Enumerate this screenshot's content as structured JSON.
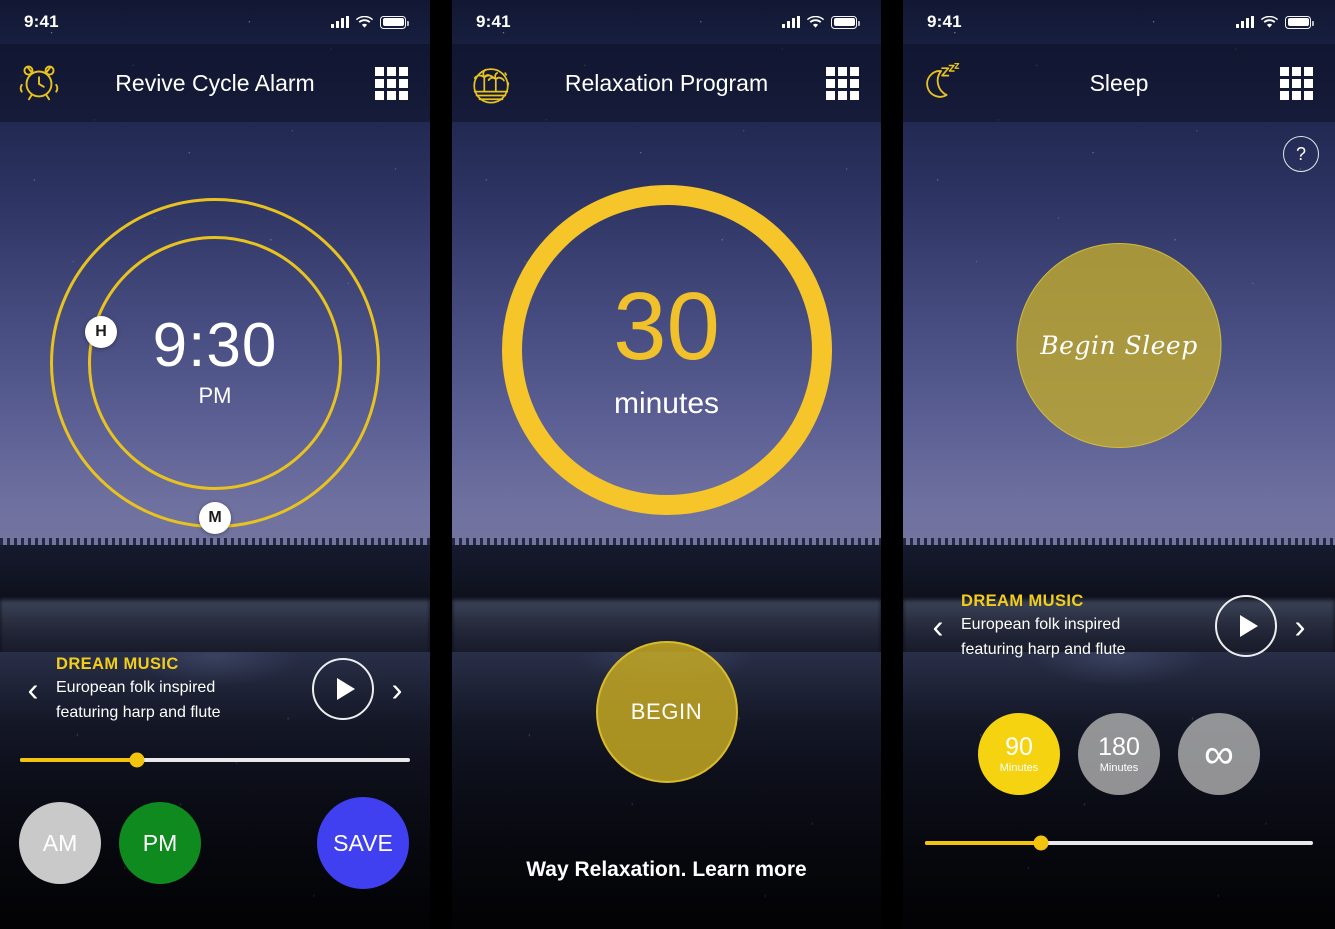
{
  "theme": {
    "accent_yellow": "#f2c40e",
    "ring_yellow": "#e8c320",
    "green": "#0f8a1e",
    "blue": "#4040f0",
    "grey": "#c9c9c9",
    "sky_top": "#121833",
    "sky_bottom": "#73749f"
  },
  "status_bar": {
    "time": "9:41",
    "signal": "signal-bars-icon",
    "wifi": "wifi-icon",
    "battery": "battery-icon"
  },
  "panels": [
    {
      "id": "revive-cycle-alarm",
      "header": {
        "icon": "alarm-clock-icon",
        "title": "Revive Cycle Alarm",
        "menu": "grid-menu-icon"
      },
      "clock": {
        "time": "9:30",
        "meridiem": "PM",
        "hour_handle_label": "H",
        "minute_handle_label": "M"
      },
      "player": {
        "prev": "‹",
        "next": "›",
        "title": "DREAM MUSIC",
        "description_line1": "European folk inspired",
        "description_line2": "featuring harp and flute",
        "play": "play-icon"
      },
      "slider": {
        "value_percent": 30
      },
      "buttons": {
        "am": {
          "label": "AM",
          "state": "inactive"
        },
        "pm": {
          "label": "PM",
          "state": "active"
        },
        "save": {
          "label": "SAVE"
        }
      }
    },
    {
      "id": "relaxation-program",
      "header": {
        "icon": "palm-island-icon",
        "title": "Relaxation Program",
        "menu": "grid-menu-icon"
      },
      "timer": {
        "value": "30",
        "unit": "minutes"
      },
      "begin_button": {
        "label": "BEGIN"
      },
      "footer": {
        "text": "Way Relaxation. Learn more"
      }
    },
    {
      "id": "sleep",
      "header": {
        "icon": "moon-zzz-icon",
        "title": "Sleep",
        "menu": "grid-menu-icon"
      },
      "help": {
        "label": "?"
      },
      "sleep_button": {
        "label": "Begin Sleep"
      },
      "player": {
        "prev": "‹",
        "next": "›",
        "title": "DREAM MUSIC",
        "description_line1": "European folk inspired",
        "description_line2": "featuring harp and flute",
        "play": "play-icon"
      },
      "durations": [
        {
          "number": "90",
          "unit": "Minutes",
          "state": "active"
        },
        {
          "number": "180",
          "unit": "Minutes",
          "state": "inactive"
        },
        {
          "number": "∞",
          "unit": "",
          "state": "inactive"
        }
      ],
      "slider": {
        "value_percent": 30
      }
    }
  ]
}
